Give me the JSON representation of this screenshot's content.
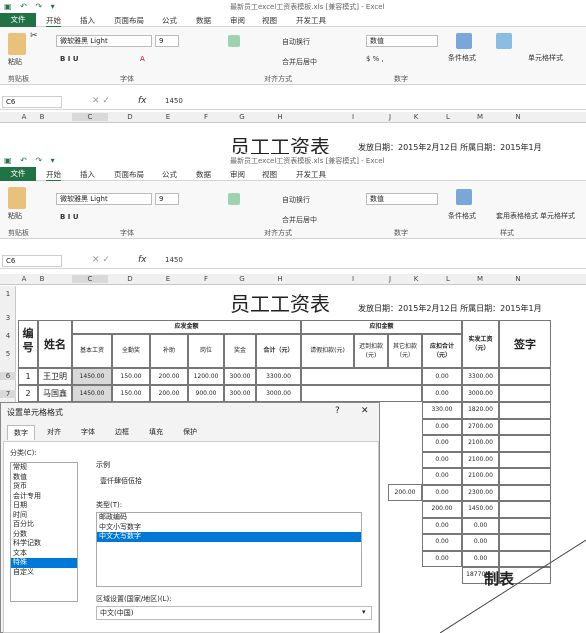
{
  "app": {
    "title": "最新员工excel工资表模板.xls [兼容模式] - Excel",
    "title2": "最新员工excel工资表模板.xls [兼容模式] - Excel"
  },
  "tabs": [
    {
      "label": "文件"
    },
    {
      "label": "开始"
    },
    {
      "label": "插入"
    },
    {
      "label": "页面布局"
    },
    {
      "label": "公式"
    },
    {
      "label": "数据"
    },
    {
      "label": "审阅"
    },
    {
      "label": "视图"
    },
    {
      "label": "开发工具"
    }
  ],
  "ribbon": {
    "paste": "粘贴",
    "font_name": "微软雅黑 Light",
    "font_size": "9",
    "wrap": "自动换行",
    "merge": "合并后居中",
    "num_format": "数值",
    "cond": "条件格式",
    "table": "套用表格格式",
    "cellstyle": "单元格样式",
    "groups": {
      "clipboard": "剪贴板",
      "font": "字体",
      "align": "对齐方式",
      "number": "数字",
      "styles": "样式"
    }
  },
  "formula": {
    "namebox": "C6",
    "fx": "fx",
    "value": "1450"
  },
  "columns": [
    "A",
    "B",
    "C",
    "D",
    "E",
    "F",
    "G",
    "H",
    "I",
    "J",
    "K",
    "L",
    "M",
    "N"
  ],
  "sheet": {
    "title": "员工工资表",
    "date": "发放日期：2015年2月12日  所属日期：2015年1月",
    "h_num": "编号",
    "h_name": "姓名",
    "h_pay": "应发金额",
    "h_ded": "应扣金额",
    "h_real": "实发工资（元）",
    "h_sign": "签字",
    "sub": [
      "基本工资",
      "全勤奖",
      "补助",
      "岗位",
      "奖金",
      "合计（元）",
      "请假扣款(元)",
      "迟到扣款(元)",
      "其它扣款（元）",
      "应扣合计（元）"
    ],
    "rows": [
      {
        "no": "1",
        "name": "王卫明",
        "vals": [
          "1450.00",
          "150.00",
          "200.00",
          "1200.00",
          "300.00",
          "3300.00"
        ],
        "ded": "0.00",
        "real": "3300.00"
      },
      {
        "no": "2",
        "name": "马国鑫",
        "vals": [
          "1450.00",
          "150.00",
          "200.00",
          "900.00",
          "300.00",
          "3000.00"
        ],
        "ded": "0.00",
        "real": "3000.00"
      }
    ],
    "ded_more": [
      "330.00",
      "0.00",
      "0.00",
      "0.00",
      "0.00",
      "0.00",
      "200.00",
      "0.00",
      "0.00",
      "0.00"
    ],
    "other_ded": "200.00",
    "real_more": [
      "1820.00",
      "2700.00",
      "2100.00",
      "2100.00",
      "2100.00",
      "2300.00",
      "1450.00",
      "0.00",
      "0.00",
      "0.00",
      "18770.00"
    ],
    "maker": "制表"
  },
  "dialog": {
    "title": "设置单元格格式",
    "help": "?",
    "close": "✕",
    "tabs": [
      "数字",
      "对齐",
      "字体",
      "边框",
      "填充",
      "保护"
    ],
    "cat_label": "分类(C):",
    "categories": [
      "常规",
      "数值",
      "货币",
      "会计专用",
      "日期",
      "时间",
      "百分比",
      "分数",
      "科学记数",
      "文本",
      "特殊",
      "自定义"
    ],
    "selected_cat": "特殊",
    "sample_label": "示例",
    "sample": "壹仟肆佰伍拾",
    "type_label": "类型(T):",
    "types": [
      "邮政编码",
      "中文小写数字",
      "中文大写数字"
    ],
    "selected_type": "中文大写数字",
    "locale_label": "区域设置(国家/地区)(L):",
    "locale": "中文(中国)"
  }
}
